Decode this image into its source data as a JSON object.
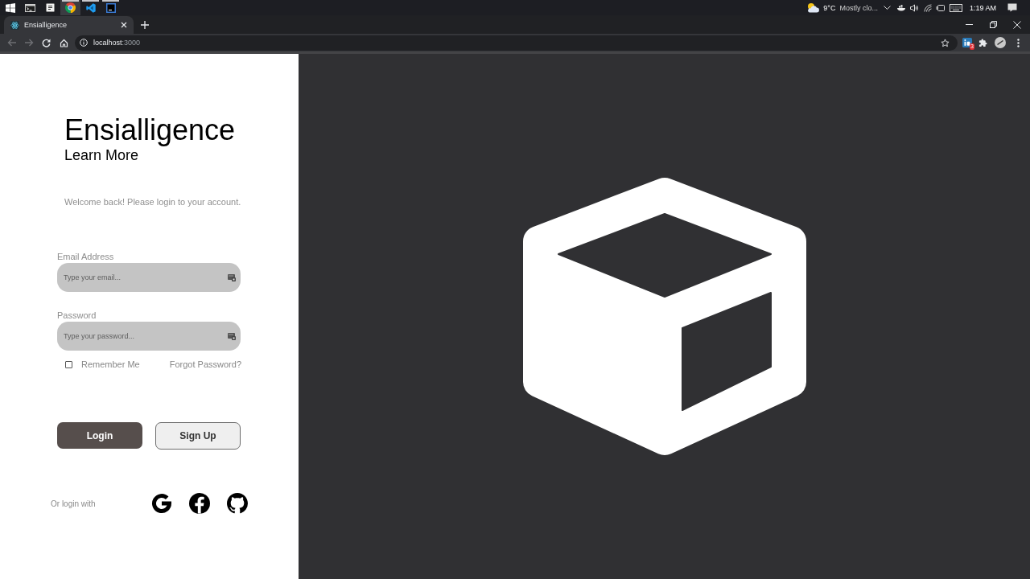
{
  "taskbar": {
    "apps": [
      {
        "kind": "terminal",
        "running": false,
        "selected": false
      },
      {
        "kind": "notes",
        "running": false,
        "selected": false
      },
      {
        "kind": "browser",
        "running": true,
        "selected": true
      },
      {
        "kind": "editor",
        "running": true,
        "selected": false
      },
      {
        "kind": "ide",
        "running": true,
        "selected": false
      }
    ],
    "weather": {
      "temperature": "9°C",
      "condition": "Mostly clo..."
    },
    "clock": "1:19 AM"
  },
  "browser": {
    "tabs": [
      {
        "title": "Ensialligence",
        "selected": true
      }
    ],
    "back": {
      "disabled": true
    },
    "forward": {
      "disabled": true
    },
    "address": {
      "host": "localhost",
      "port": ":3000"
    },
    "extension_badge": "3"
  },
  "login": {
    "brand": "Ensialligence",
    "learn_more": "Learn More",
    "welcome": "Welcome back! Please login to your account.",
    "fields": [
      {
        "label": "Email Address",
        "placeholder": "Type your email..."
      },
      {
        "label": "Password",
        "placeholder": "Type your password..."
      }
    ],
    "remember": {
      "label": "Remember Me",
      "checked": false
    },
    "forgot": "Forgot Password?",
    "buttons": [
      {
        "kind": "primary",
        "label": "Login"
      },
      {
        "kind": "secondary",
        "label": "Sign Up"
      }
    ],
    "social_label": "Or login with"
  }
}
